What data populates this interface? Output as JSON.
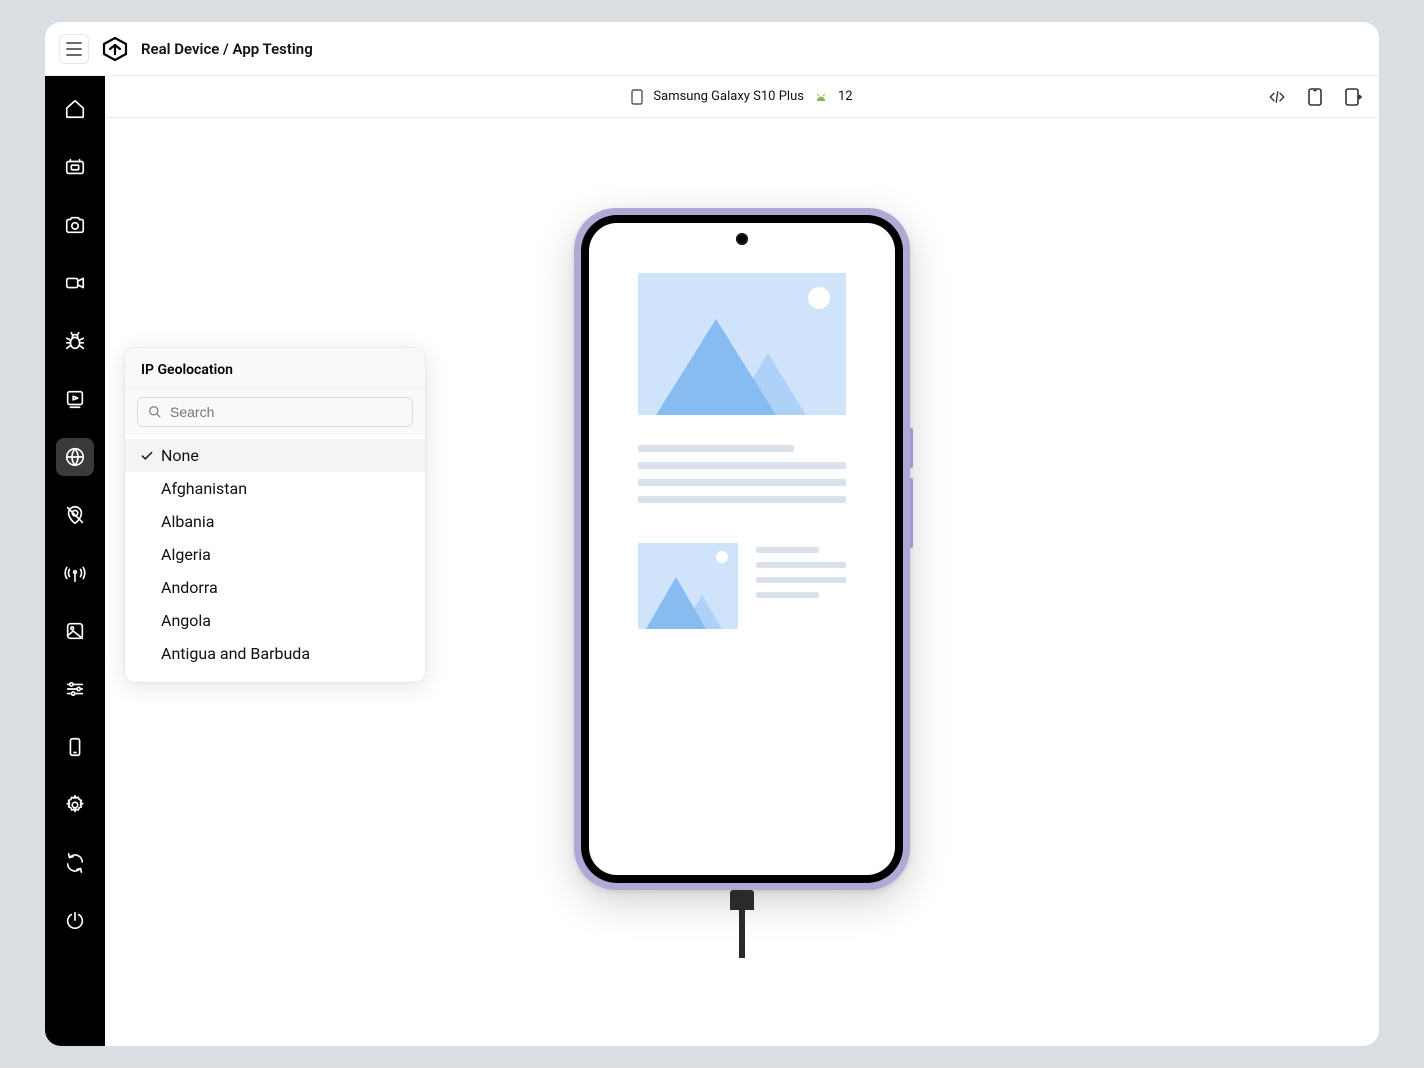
{
  "header": {
    "breadcrumb": "Real Device / App Testing"
  },
  "deviceBar": {
    "deviceName": "Samsung Galaxy S10 Plus",
    "osVersion": "12"
  },
  "sidebar": {
    "items": [
      {
        "name": "home"
      },
      {
        "name": "app"
      },
      {
        "name": "camera"
      },
      {
        "name": "video"
      },
      {
        "name": "bug"
      },
      {
        "name": "play"
      },
      {
        "name": "globe"
      },
      {
        "name": "map-off"
      },
      {
        "name": "network"
      },
      {
        "name": "gallery"
      },
      {
        "name": "settings-sliders"
      },
      {
        "name": "device"
      },
      {
        "name": "gear"
      },
      {
        "name": "sync"
      },
      {
        "name": "power"
      }
    ]
  },
  "popover": {
    "title": "IP Geolocation",
    "searchPlaceholder": "Search",
    "selected": "None",
    "options": [
      "None",
      "Afghanistan",
      "Albania",
      "Algeria",
      "Andorra",
      "Angola",
      "Antigua and Barbuda"
    ]
  }
}
